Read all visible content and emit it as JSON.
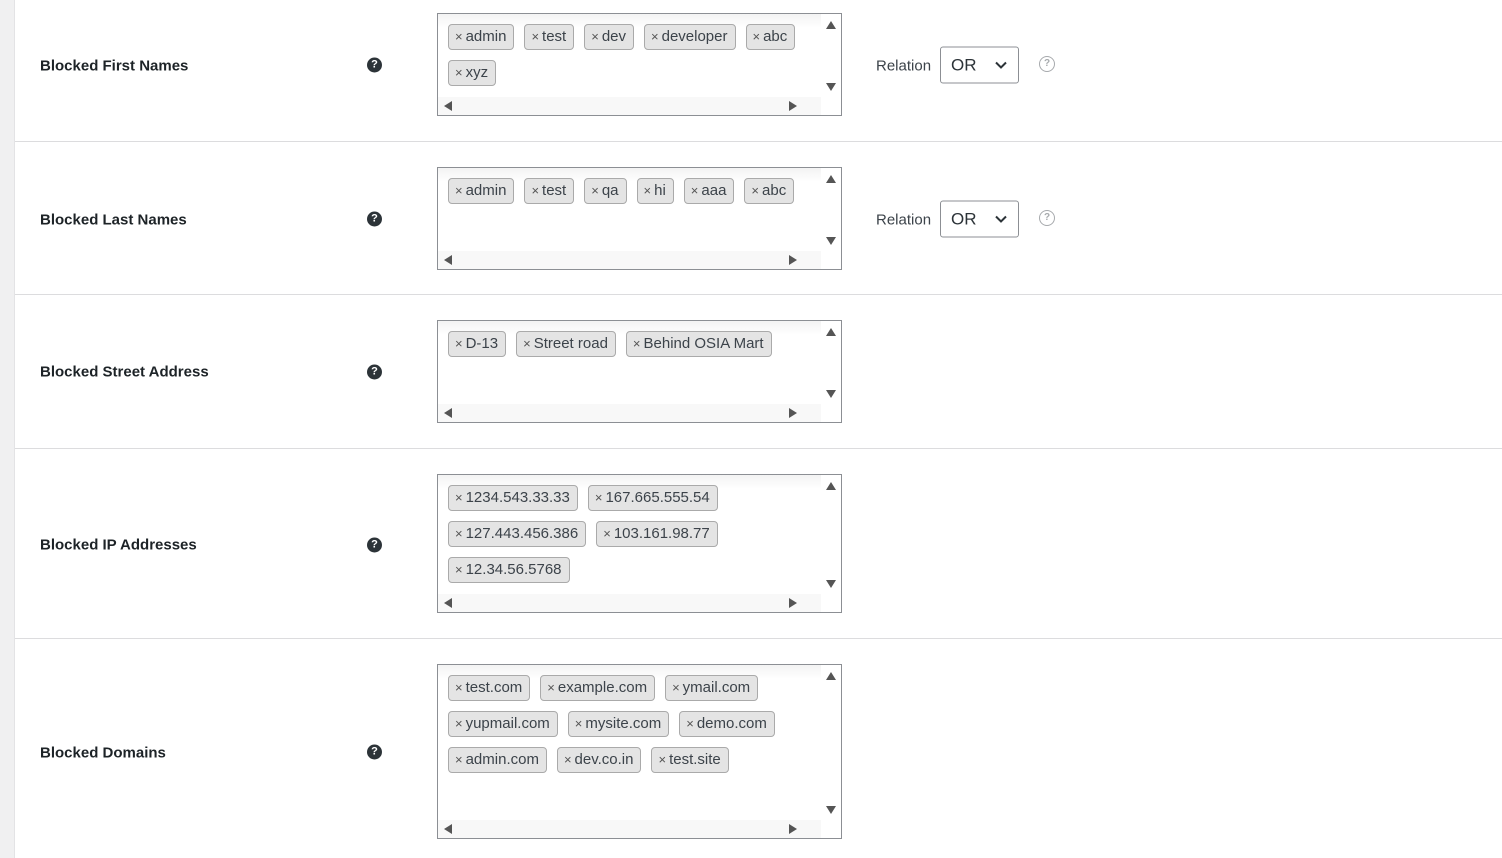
{
  "rows": [
    {
      "label": "Blocked First Names",
      "tags": [
        "admin",
        "test",
        "dev",
        "developer",
        "abc",
        "xyz"
      ],
      "relation": {
        "label": "Relation",
        "value": "OR"
      }
    },
    {
      "label": "Blocked Last Names",
      "tags": [
        "admin",
        "test",
        "qa",
        "hi",
        "aaa",
        "abc"
      ],
      "relation": {
        "label": "Relation",
        "value": "OR"
      }
    },
    {
      "label": "Blocked Street Address",
      "tags": [
        "D-13",
        "Street road",
        "Behind OSIA Mart"
      ]
    },
    {
      "label": "Blocked IP Addresses",
      "tags": [
        "1234.543.33.33",
        "167.665.555.54",
        "127.443.456.386",
        "103.161.98.77",
        "12.34.56.5768"
      ]
    },
    {
      "label": "Blocked Domains",
      "tags": [
        "test.com",
        "example.com",
        "ymail.com",
        "yupmail.com",
        "mysite.com",
        "demo.com",
        "admin.com",
        "dev.co.in",
        "test.site"
      ]
    }
  ],
  "icons": {
    "remove": "×",
    "help_dark": "?",
    "help_outline": "?"
  },
  "colors": {
    "tag_bg": "#e4e4e4",
    "tag_border": "#aaaaaa",
    "row_divider": "#dcdcde"
  }
}
